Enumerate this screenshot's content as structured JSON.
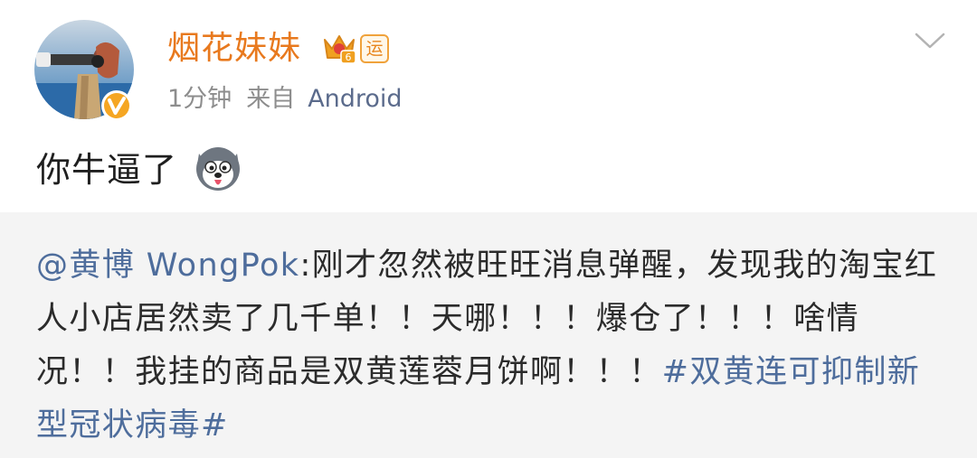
{
  "post": {
    "author": {
      "name": "烟花妹妹",
      "avatar_icon": "avatar-photographer-icon",
      "verified_icon": "verified-v-icon",
      "member_badge_icon": "crown-level-6-icon",
      "yun_badge": "运"
    },
    "time": "1分钟",
    "from_label": "来自",
    "source": "Android",
    "text": "你牛逼了",
    "emoji_icon": "husky-dog-emoji-icon",
    "menu_icon": "chevron-down-icon"
  },
  "repost": {
    "mention": "@黄博 WongPok",
    "body": ":刚才忽然被旺旺消息弹醒，发现我的淘宝红人小店居然卖了几千单！！天哪！！！爆仓了！！！啥情况！！我挂的商品是双黄莲蓉月饼啊！！！",
    "hashtag": "#双黄连可抑制新型冠状病毒#"
  },
  "colors": {
    "username": "#e8791e",
    "link": "#4e6d9c",
    "meta": "#8d8d8d",
    "repost_bg": "#f4f4f4"
  }
}
